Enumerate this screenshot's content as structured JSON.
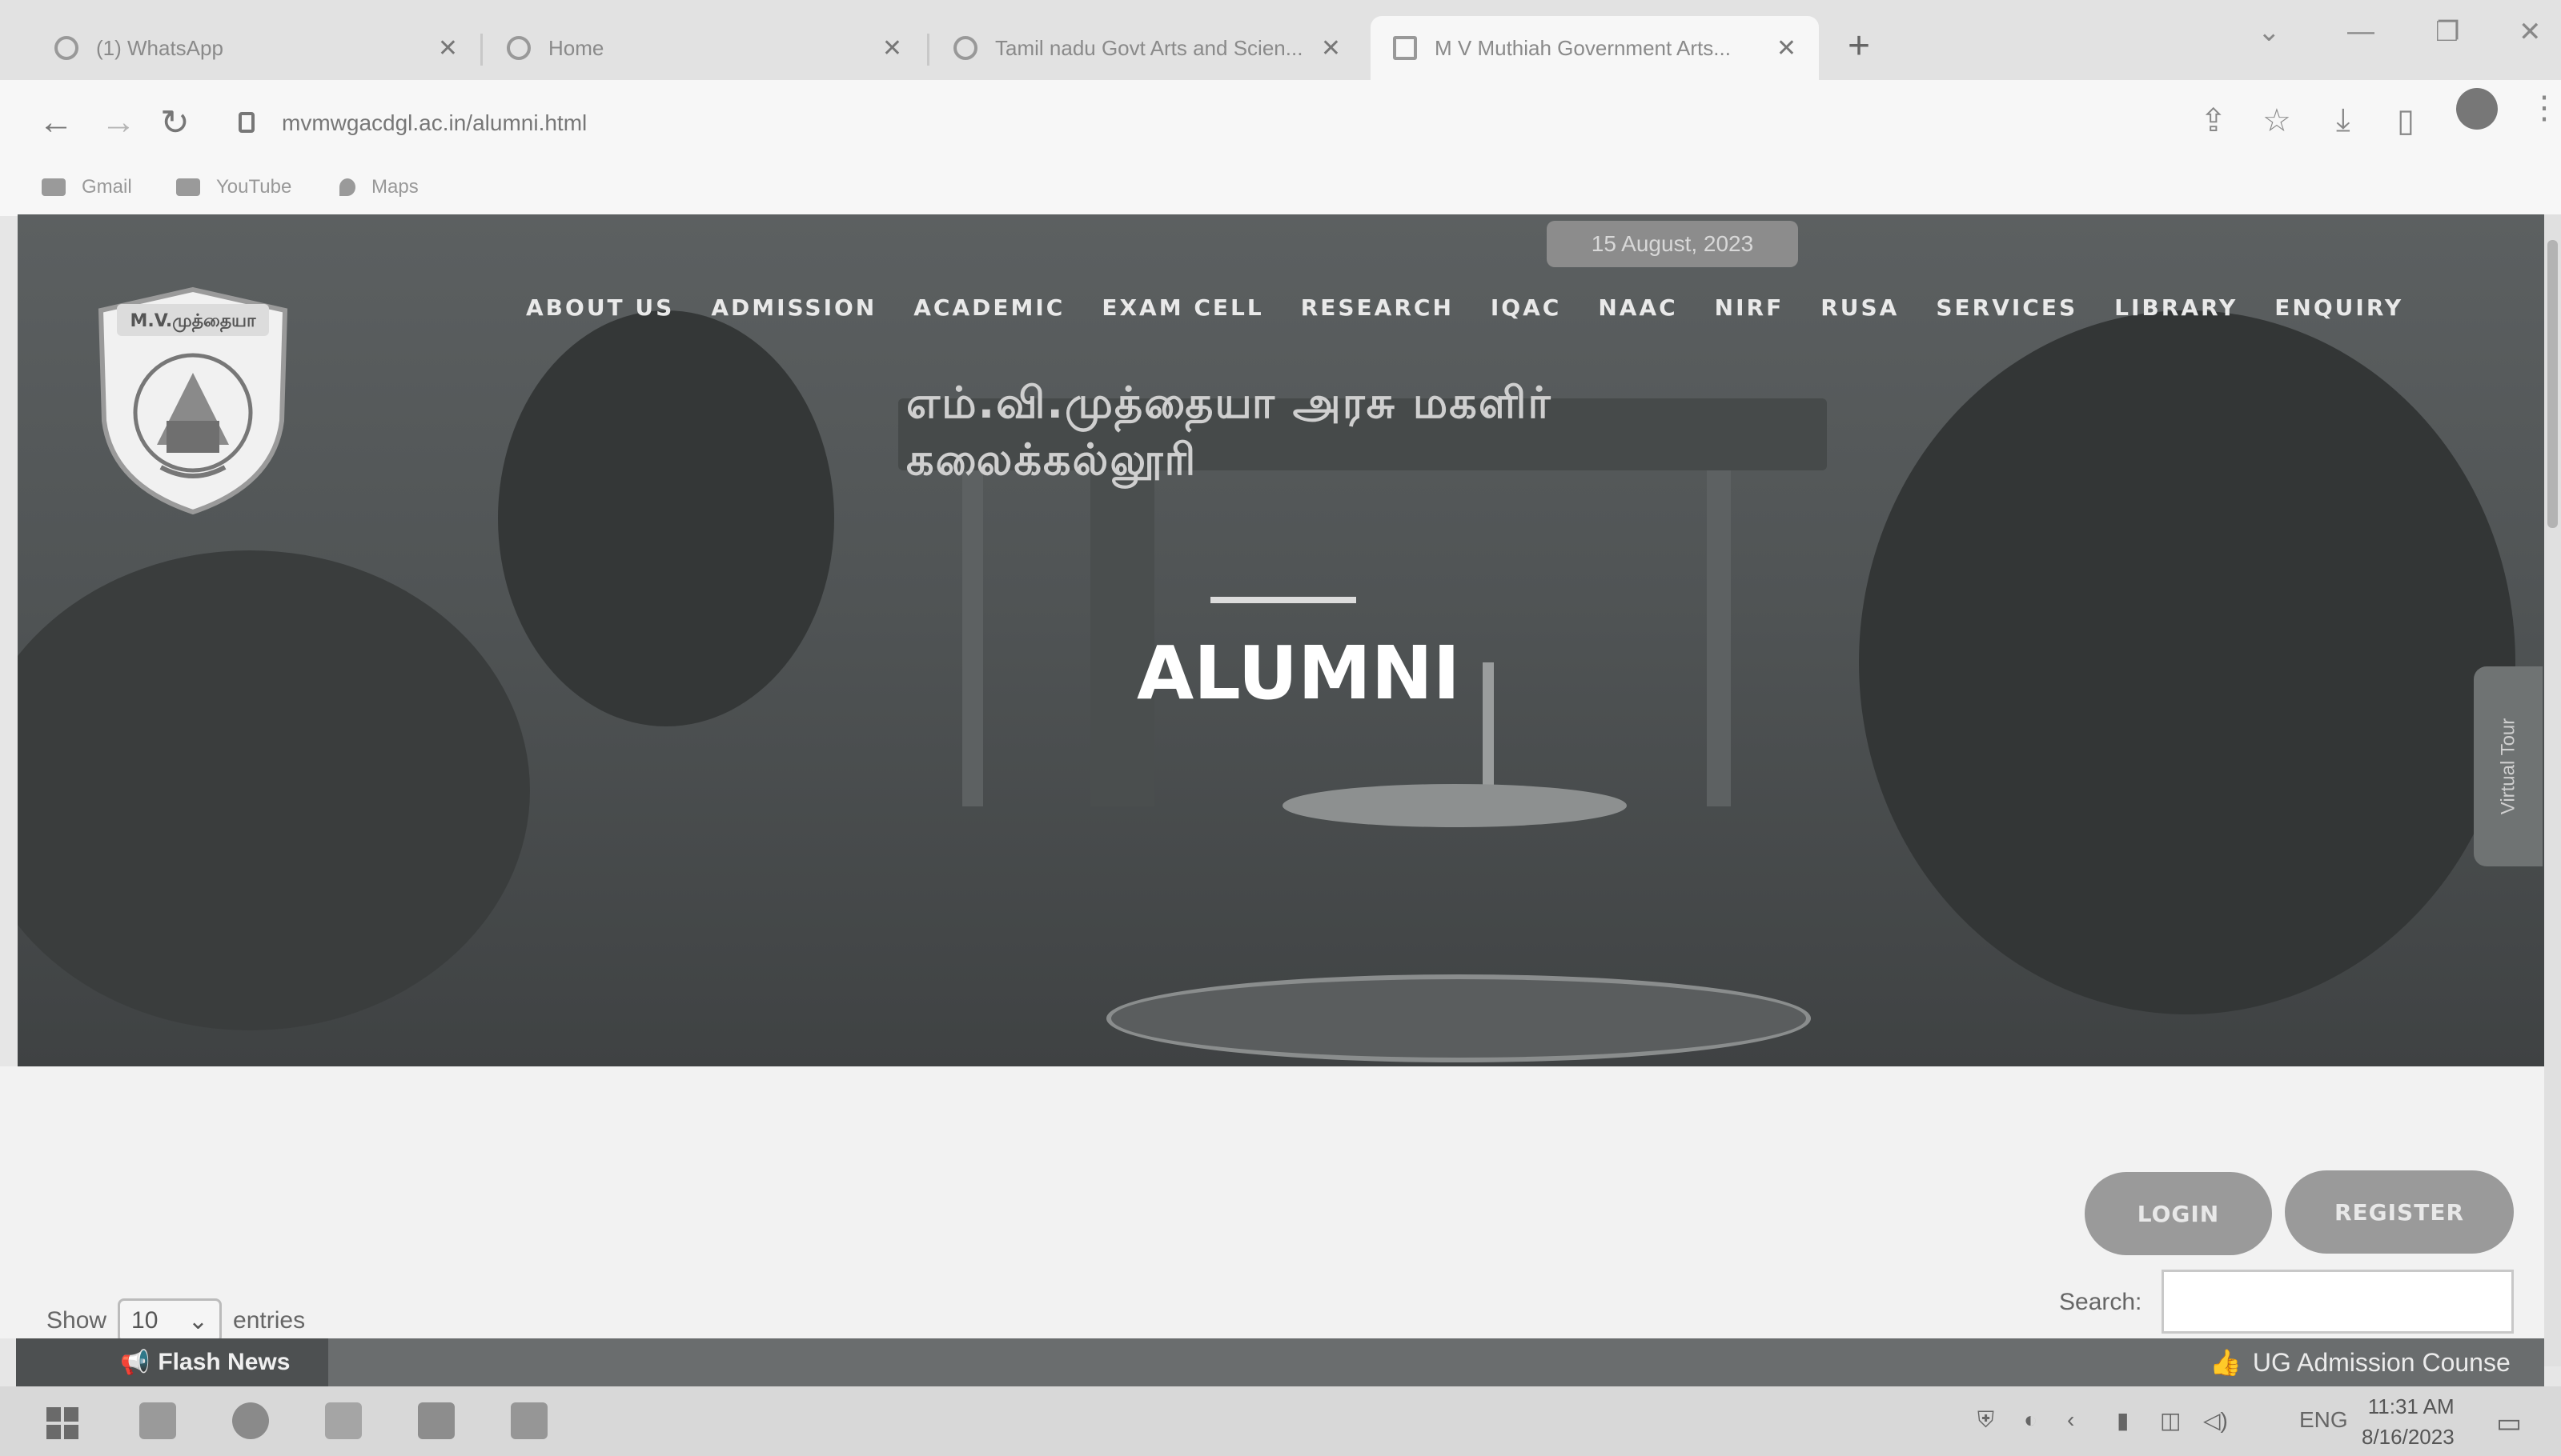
{
  "browser": {
    "tabs": [
      {
        "title": "(1) WhatsApp",
        "active": false
      },
      {
        "title": "Home",
        "active": false
      },
      {
        "title": "Tamil nadu Govt Arts and Scien...",
        "active": false
      },
      {
        "title": "M V Muthiah Government Arts...",
        "active": true
      }
    ],
    "new_tab": "+",
    "url": "mvmwgacdgl.ac.in/alumni.html",
    "bookmarks": [
      "Gmail",
      "YouTube",
      "Maps"
    ]
  },
  "site": {
    "logo_text": "M.V.முத்தையா",
    "date_badge": "15 August, 2023",
    "nav": [
      "ABOUT US",
      "ADMISSION",
      "ACADEMIC",
      "EXAM CELL",
      "RESEARCH",
      "IQAC",
      "NAAC",
      "NIRF",
      "RUSA",
      "SERVICES",
      "LIBRARY",
      "ENQUIRY"
    ],
    "building_sign": "எம்.வி.முத்தையா அரசு மகளிர் கலைக்கல்லூரி",
    "page_title": "ALUMNI",
    "virtual_tour": "Virtual Tour",
    "login_label": "LOGIN",
    "register_label": "REGISTER",
    "table": {
      "show_label": "Show",
      "entries_value": "10",
      "entries_label": "entries",
      "search_label": "Search:"
    },
    "flash_news": {
      "label": "Flash News",
      "ticker": "UG Admission Counse"
    }
  },
  "taskbar": {
    "language": "ENG",
    "time": "11:31 AM",
    "date": "8/16/2023"
  },
  "colors": {
    "hero_overlay": "#505455",
    "button": "#9a9a9a",
    "flash_bar": "#6a6d6e"
  }
}
